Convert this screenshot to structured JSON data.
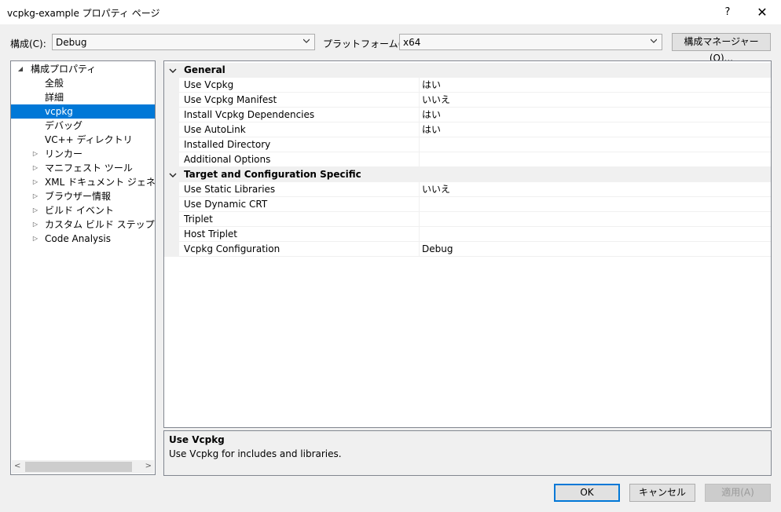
{
  "window": {
    "title": "vcpkg-example プロパティ ページ",
    "help": "?",
    "close": "✕"
  },
  "toolbar": {
    "config_label": "構成(C):",
    "config_value": "Debug",
    "platform_label": "プラットフォーム(P):",
    "platform_value": "x64",
    "manager_button": "構成マネージャー(O)..."
  },
  "tree": {
    "items": [
      {
        "label": "構成プロパティ",
        "expander": "◢"
      },
      {
        "label": "全般"
      },
      {
        "label": "詳細"
      },
      {
        "label": "vcpkg"
      },
      {
        "label": "デバッグ"
      },
      {
        "label": "VC++ ディレクトリ"
      },
      {
        "label": "リンカー",
        "expander": "▷"
      },
      {
        "label": "マニフェスト ツール",
        "expander": "▷"
      },
      {
        "label": "XML ドキュメント ジェネレーター",
        "expander": "▷"
      },
      {
        "label": "ブラウザー情報",
        "expander": "▷"
      },
      {
        "label": "ビルド イベント",
        "expander": "▷"
      },
      {
        "label": "カスタム ビルド ステップ",
        "expander": "▷"
      },
      {
        "label": "Code Analysis",
        "expander": "▷"
      }
    ],
    "scroll_left": "<",
    "scroll_right": ">"
  },
  "grid": {
    "categories": [
      {
        "name": "General",
        "properties": [
          {
            "name": "Use Vcpkg",
            "value": "はい"
          },
          {
            "name": "Use Vcpkg Manifest",
            "value": "いいえ"
          },
          {
            "name": "Install Vcpkg Dependencies",
            "value": "はい"
          },
          {
            "name": "Use AutoLink",
            "value": "はい"
          },
          {
            "name": "Installed Directory",
            "value": ""
          },
          {
            "name": "Additional Options",
            "value": ""
          }
        ]
      },
      {
        "name": "Target and Configuration Specific",
        "properties": [
          {
            "name": "Use Static Libraries",
            "value": "いいえ"
          },
          {
            "name": "Use Dynamic CRT",
            "value": ""
          },
          {
            "name": "Triplet",
            "value": ""
          },
          {
            "name": "Host Triplet",
            "value": ""
          },
          {
            "name": "Vcpkg Configuration",
            "value": "Debug"
          }
        ]
      }
    ]
  },
  "description": {
    "title": "Use Vcpkg",
    "body": "Use Vcpkg for includes and libraries."
  },
  "buttons": {
    "ok": "OK",
    "cancel": "キャンセル",
    "apply": "適用(A)"
  },
  "colors": {
    "accent": "#0078d7",
    "dialog_bg": "#f0f0f0"
  },
  "icons": {
    "dropdown": "chevron-down-icon",
    "expanded": "triangle-down-icon",
    "collapsed": "triangle-right-icon",
    "category": "chevron-down-icon"
  }
}
